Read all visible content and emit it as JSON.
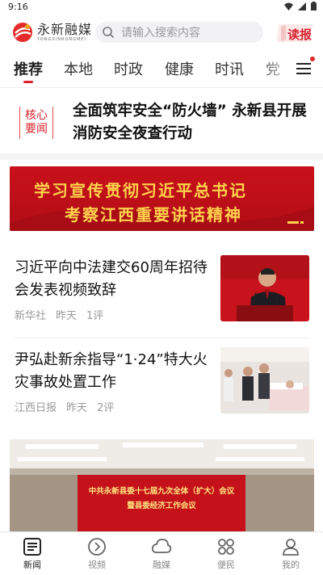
{
  "status_bar": {
    "time": "9:16"
  },
  "header": {
    "logo_cn": "永新融媒",
    "logo_en": "YONGXINRONGMEI",
    "search_placeholder": "请输入搜索内容",
    "dubao_label": "读报"
  },
  "tabs": [
    {
      "label": "推荐",
      "active": true
    },
    {
      "label": "本地"
    },
    {
      "label": "时政"
    },
    {
      "label": "健康"
    },
    {
      "label": "时讯"
    },
    {
      "label": "党"
    }
  ],
  "core_news": {
    "badge_line1": "核心",
    "badge_line2": "要闻",
    "headline": "全面筑牢安全“防火墙” 永新县开展消防安全夜查行动"
  },
  "banner": {
    "line1": "学习宣传贯彻习近平总书记",
    "line2": "考察江西重要讲话精神"
  },
  "articles": [
    {
      "title": "习近平向中法建交60周年招待会发表视频致辞",
      "source": "新华社",
      "time": "昨天",
      "comments": "1评"
    },
    {
      "title": "尹弘赴新余指导“1·24”特大火灾事故处置工作",
      "source": "江西日报",
      "time": "昨天",
      "comments": "2评"
    }
  ],
  "featured_image": {
    "screen_line1": "中共永新县委十七届九次全体（扩大）会议",
    "screen_line2": "暨县委经济工作会议"
  },
  "bottom_nav": [
    {
      "label": "新闻",
      "icon": "news-icon",
      "active": true
    },
    {
      "label": "视频",
      "icon": "play-icon"
    },
    {
      "label": "融媒",
      "icon": "cloud-icon"
    },
    {
      "label": "便民",
      "icon": "grid-icon"
    },
    {
      "label": "我的",
      "icon": "person-icon"
    }
  ],
  "colors": {
    "accent": "#d9232e",
    "banner_text": "#ffd34d"
  }
}
